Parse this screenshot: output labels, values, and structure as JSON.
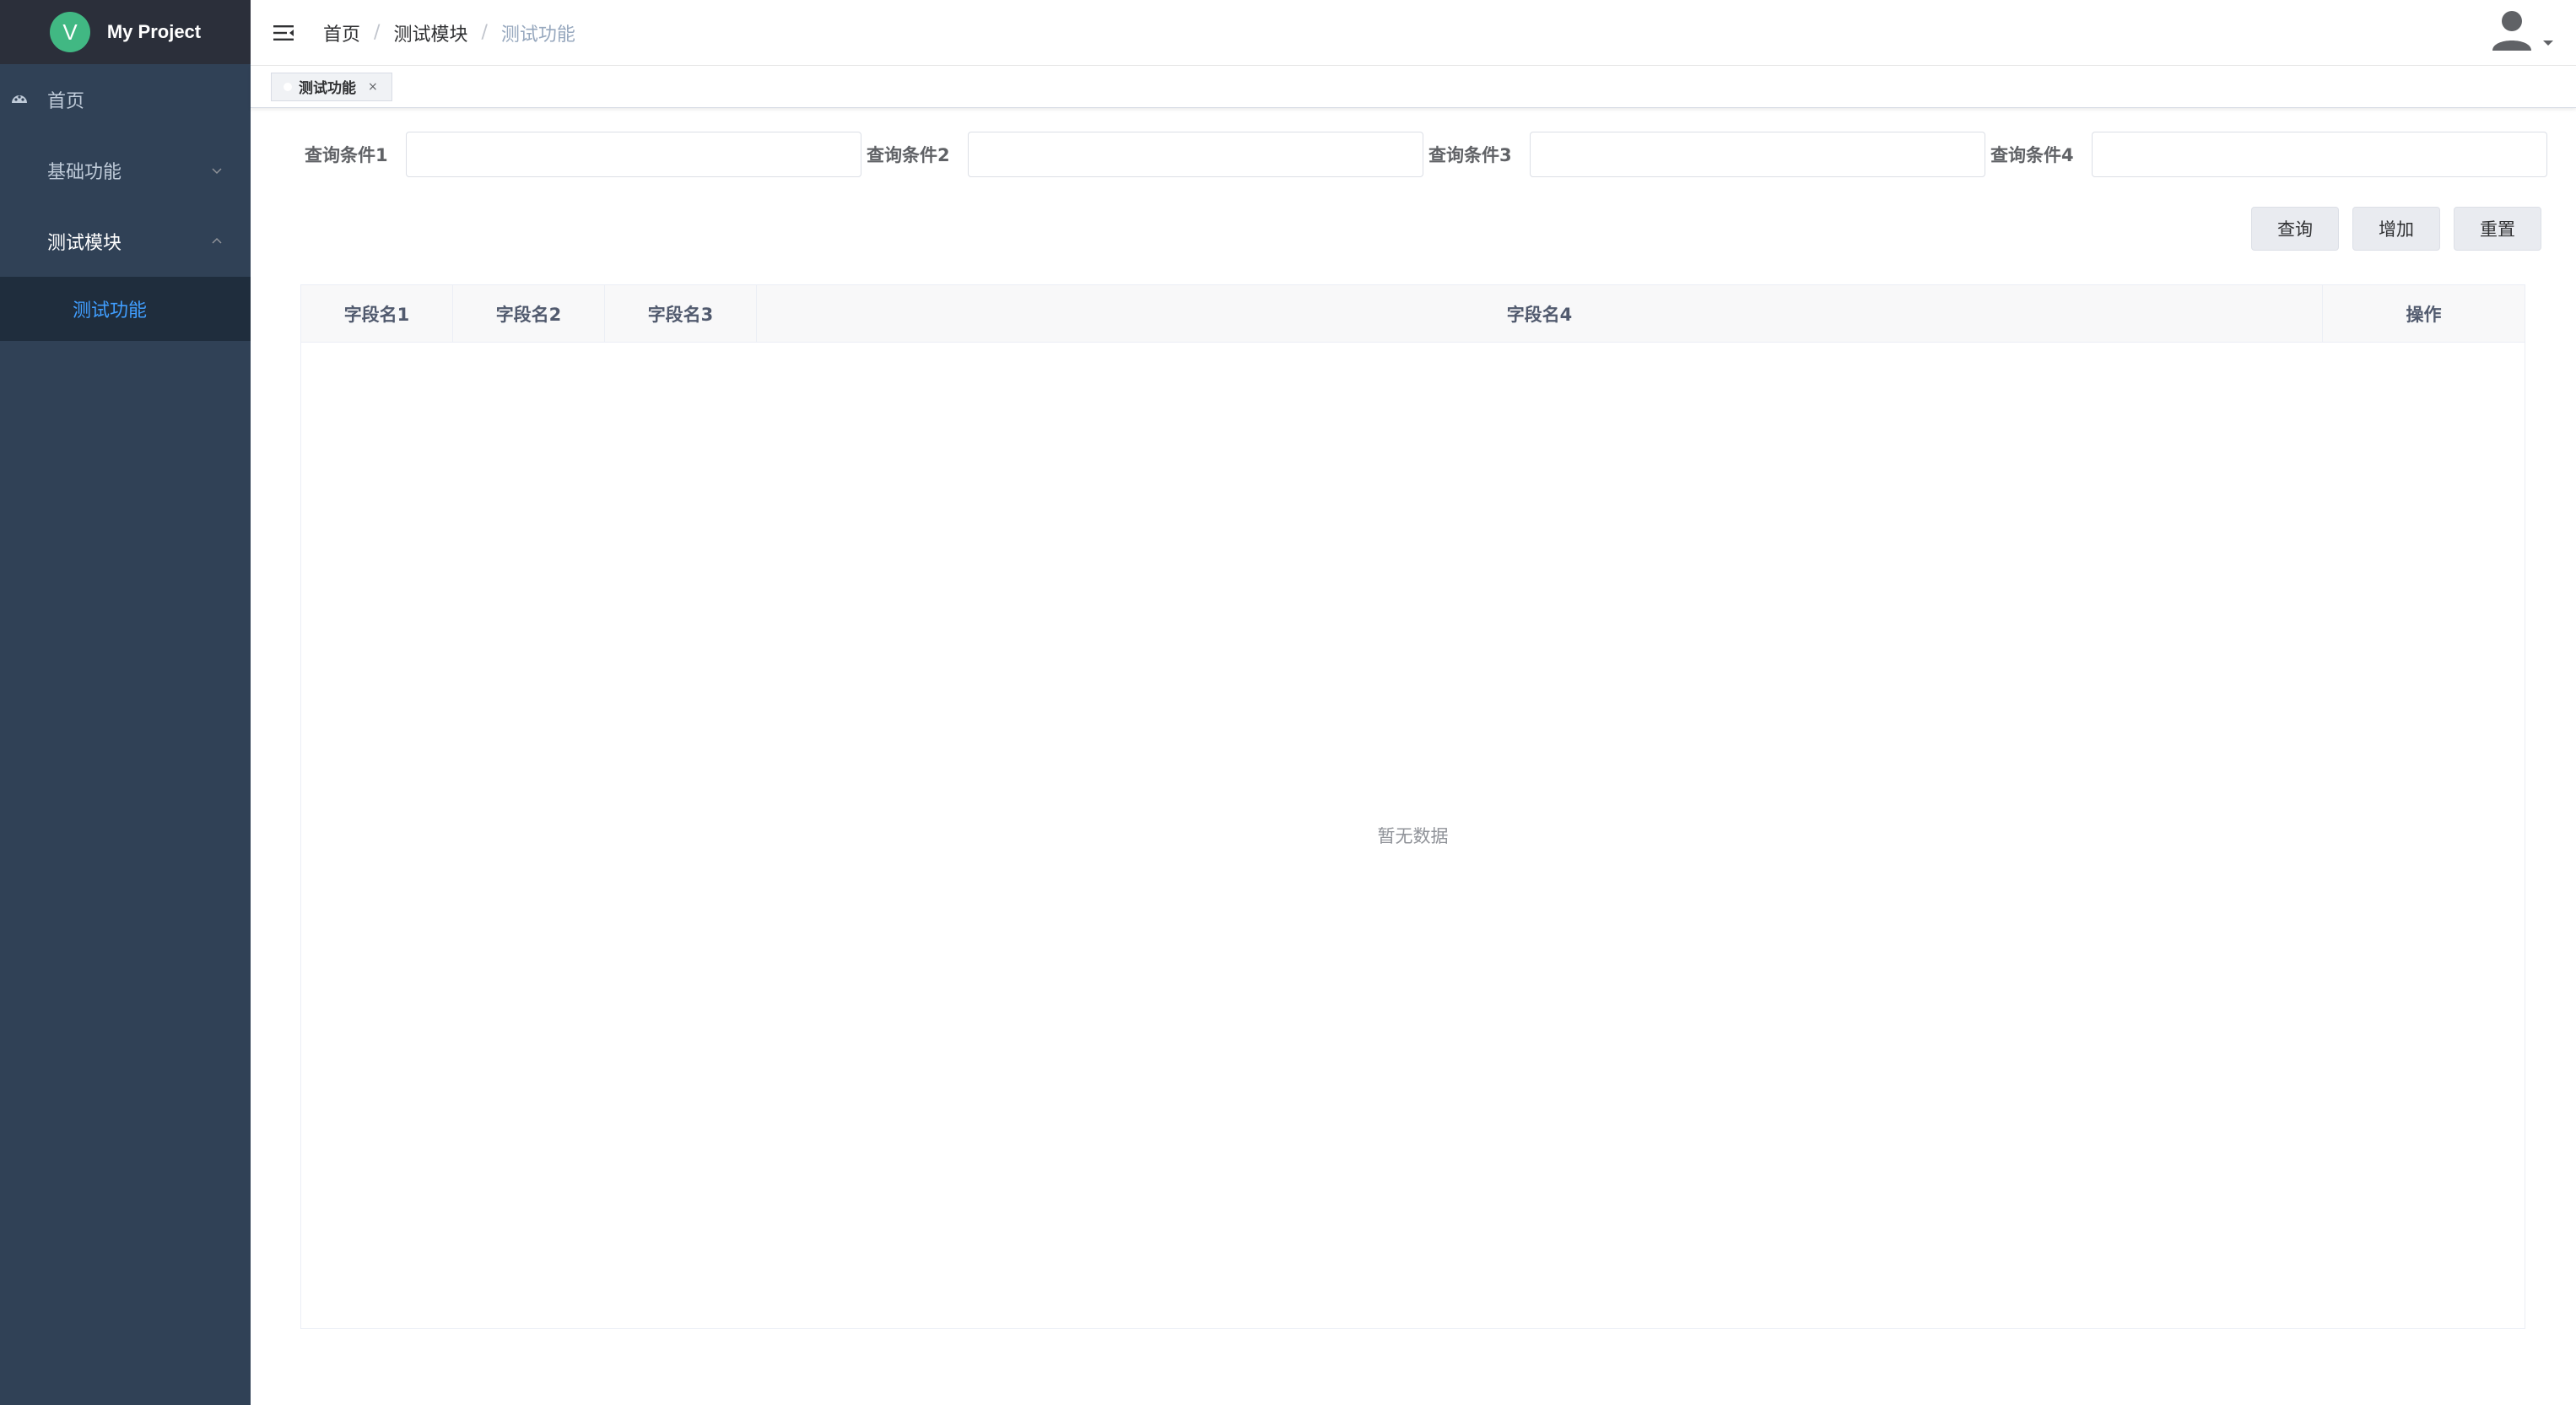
{
  "app": {
    "title": "My Project"
  },
  "sidebar": {
    "items": [
      {
        "label": "首页",
        "icon": "dashboard-icon"
      },
      {
        "label": "基础功能",
        "expanded": false
      },
      {
        "label": "测试模块",
        "expanded": true,
        "children": [
          {
            "label": "测试功能",
            "active": true
          }
        ]
      }
    ]
  },
  "header": {
    "breadcrumb": [
      "首页",
      "测试模块",
      "测试功能"
    ],
    "breadcrumb_separator": "/"
  },
  "tags": [
    {
      "label": "测试功能",
      "close": "×",
      "active": true
    }
  ],
  "search": {
    "fields": [
      {
        "label": "查询条件1",
        "value": ""
      },
      {
        "label": "查询条件2",
        "value": ""
      },
      {
        "label": "查询条件3",
        "value": ""
      },
      {
        "label": "查询条件4",
        "value": ""
      }
    ]
  },
  "buttons": {
    "query": "查询",
    "add": "增加",
    "reset": "重置"
  },
  "table": {
    "columns": [
      "字段名1",
      "字段名2",
      "字段名3",
      "字段名4",
      "操作"
    ],
    "rows": [],
    "empty_text": "暂无数据"
  },
  "colors": {
    "sidebar_bg": "#304156",
    "logo_bar_bg": "#2b2f3a",
    "active_menu": "#409eff",
    "logo_green": "#41b883"
  }
}
